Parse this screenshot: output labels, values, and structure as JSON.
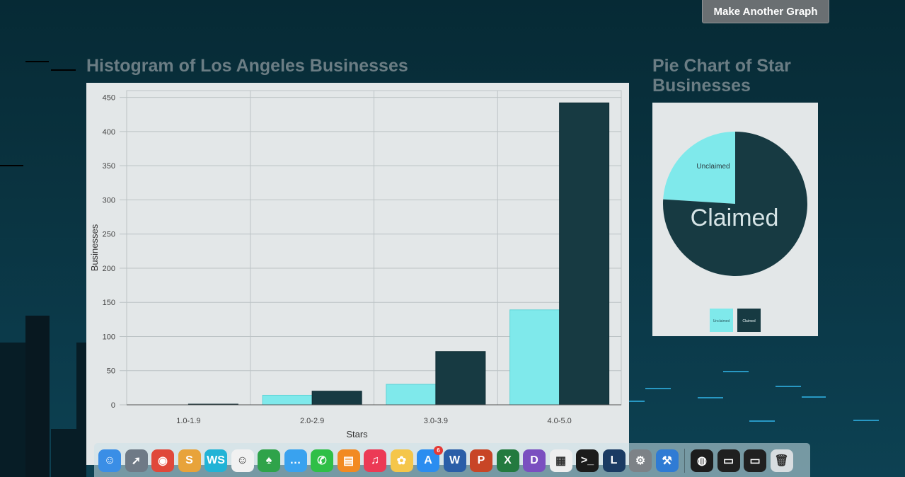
{
  "header": {
    "button_label": "Make Another Graph"
  },
  "histogram": {
    "heading": "Histogram of Los Angeles Businesses"
  },
  "pie": {
    "heading_line1": "Pie Chart of Star",
    "heading_line2": "Businesses"
  },
  "chart_data": [
    {
      "type": "bar",
      "title": "Histogram of Los Angeles Businesses",
      "xlabel": "Stars",
      "ylabel": "Businesses",
      "categories": [
        "1.0-1.9",
        "2.0-2.9",
        "3.0-3.9",
        "4.0-5.0"
      ],
      "series": [
        {
          "name": "Unclaimed",
          "color": "#7fe9eb",
          "values": [
            0,
            14,
            30,
            139
          ]
        },
        {
          "name": "Claimed",
          "color": "#173a42",
          "values": [
            1,
            20,
            78,
            442
          ]
        }
      ],
      "ylim": [
        0,
        460
      ],
      "yticks": [
        0,
        50,
        100,
        150,
        200,
        250,
        300,
        350,
        400,
        450
      ],
      "grid": true
    },
    {
      "type": "pie",
      "title": "Pie Chart of Star Businesses",
      "labels": [
        "Unclaimed",
        "Claimed"
      ],
      "values": [
        24,
        76
      ],
      "colors": [
        "#7fe9eb",
        "#173a42"
      ],
      "legend": "bottom"
    }
  ],
  "dock": {
    "icons": [
      {
        "name": "finder-icon",
        "color": "#3a8ee6",
        "glyph": "☺"
      },
      {
        "name": "launchpad-icon",
        "color": "#6f7a86",
        "glyph": "➚"
      },
      {
        "name": "chrome-icon",
        "color": "#e0483a",
        "glyph": "◉"
      },
      {
        "name": "slack-icon",
        "color": "#e8a33a",
        "glyph": "S"
      },
      {
        "name": "webstorm-icon",
        "color": "#21b3d6",
        "glyph": "WS"
      },
      {
        "name": "smiley-app-icon",
        "color": "#f1f1f1",
        "glyph": "☺"
      },
      {
        "name": "evernote-icon",
        "color": "#2fa34a",
        "glyph": "♠"
      },
      {
        "name": "messages-icon",
        "color": "#39a2ef",
        "glyph": "…"
      },
      {
        "name": "facetime-icon",
        "color": "#2fbf47",
        "glyph": "✆"
      },
      {
        "name": "ibooks-icon",
        "color": "#f28a22",
        "glyph": "▤"
      },
      {
        "name": "itunes-icon",
        "color": "#ec3a55",
        "glyph": "♫"
      },
      {
        "name": "photos-icon",
        "color": "#f5c64a",
        "glyph": "✿"
      },
      {
        "name": "app-store-icon",
        "color": "#2b8df0",
        "glyph": "A",
        "badge": "6"
      },
      {
        "name": "word-icon",
        "color": "#2a5ea8",
        "glyph": "W"
      },
      {
        "name": "powerpoint-icon",
        "color": "#c84526",
        "glyph": "P"
      },
      {
        "name": "excel-icon",
        "color": "#237a3f",
        "glyph": "X"
      },
      {
        "name": "dash-icon",
        "color": "#7a4fc0",
        "glyph": "D"
      },
      {
        "name": "grid-app-icon",
        "color": "#eeeeee",
        "glyph": "▦"
      },
      {
        "name": "terminal-icon",
        "color": "#1b1b1b",
        "glyph": ">_"
      },
      {
        "name": "league-of-legends-icon",
        "color": "#1a3b63",
        "glyph": "L"
      },
      {
        "name": "system-preferences-icon",
        "color": "#7d8287",
        "glyph": "⚙"
      },
      {
        "name": "xcode-icon",
        "color": "#2f7bd4",
        "glyph": "⚒"
      },
      {
        "name": "screen-recorder-icon",
        "color": "#1c1c1c",
        "glyph": "◍"
      },
      {
        "name": "window-preview-icon",
        "color": "#202020",
        "glyph": "▭"
      },
      {
        "name": "window-preview-2-icon",
        "color": "#202020",
        "glyph": "▭"
      },
      {
        "name": "trash-icon",
        "color": "#d8dde0",
        "glyph": "🗑"
      }
    ]
  }
}
